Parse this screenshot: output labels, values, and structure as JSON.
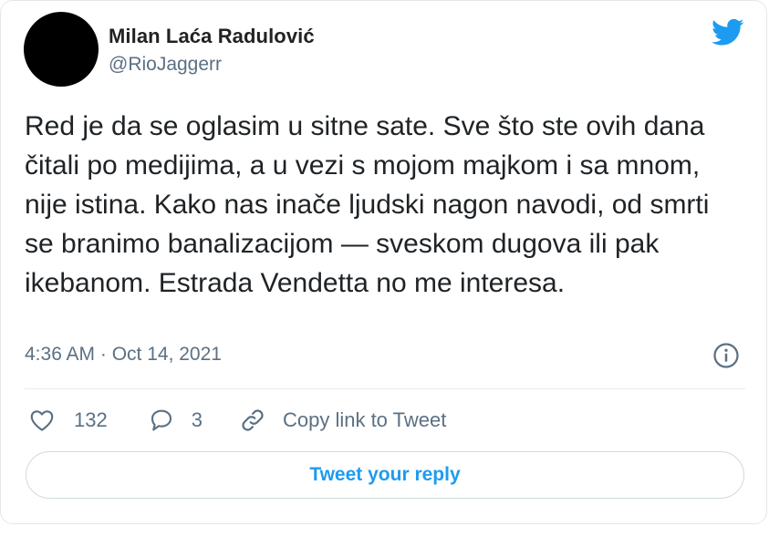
{
  "author": {
    "display_name": "Milan Laća Radulović",
    "handle": "@RioJaggerr"
  },
  "tweet": {
    "text": "Red je da se oglasim u sitne sate. Sve što ste ovih dana čitali po medijima, a u vezi s mojom majkom i sa mnom, nije istina. Kako nas inače ljudski nagon navodi, od smrti se branimo banalizacijom — sveskom dugova ili pak ikebanom. Estrada Vendetta no me interesa.",
    "timestamp": "4:36 AM · Oct 14, 2021"
  },
  "actions": {
    "likes": "132",
    "replies": "3",
    "copy_link_label": "Copy link to Tweet"
  },
  "reply_button_label": "Tweet your reply",
  "icons": {
    "logo": "twitter-bird-icon",
    "info": "info-icon",
    "like": "heart-icon",
    "reply": "speech-bubble-icon",
    "copy_link": "link-icon"
  },
  "colors": {
    "accent": "#1d9bf0",
    "secondary_text": "#5b7083",
    "border": "#cfd9de"
  }
}
